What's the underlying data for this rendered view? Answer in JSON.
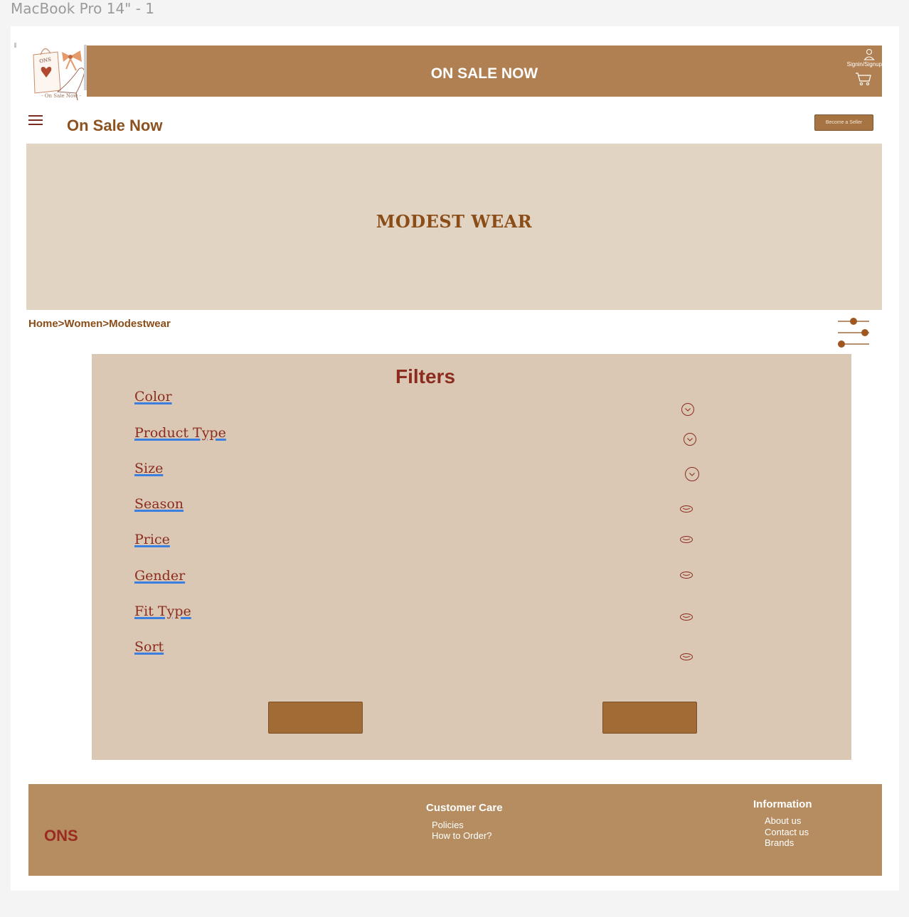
{
  "frame_title": "MacBook Pro 14\" - 1",
  "logo": {
    "text": "ONS",
    "tagline": "- On Sale Now -"
  },
  "header": {
    "title": "ON SALE NOW",
    "signin_label": "Signin/Signup",
    "icons": [
      "user-icon",
      "cart-icon"
    ]
  },
  "nav": {
    "brand": "On Sale Now",
    "become_seller_label": "Become a Seller",
    "menu_icon": "hamburger-icon"
  },
  "banner": {
    "title": "MODEST WEAR"
  },
  "breadcrumb": "Home>Women>Modestwear",
  "filters": {
    "title": "Filters",
    "items": [
      {
        "label": "Color",
        "icon": "chevron-circle-icon"
      },
      {
        "label": "Product Type",
        "icon": "chevron-circle-icon"
      },
      {
        "label": "Size",
        "icon": "chevron-circle-icon"
      },
      {
        "label": "Season",
        "icon": "lip-chevron-icon"
      },
      {
        "label": "Price",
        "icon": "lip-chevron-icon"
      },
      {
        "label": "Gender",
        "icon": "lip-chevron-icon"
      },
      {
        "label": "Fit Type",
        "icon": "lip-chevron-icon"
      },
      {
        "label": "Sort",
        "icon": "lip-chevron-icon"
      }
    ]
  },
  "footer": {
    "brand": "ONS",
    "customer_care": {
      "heading": "Customer Care",
      "links": [
        "Policies",
        "How to Order?"
      ]
    },
    "information": {
      "heading": "Information",
      "links": [
        "About us",
        "Contact us",
        "Brands"
      ]
    }
  },
  "colors": {
    "header_bg": "#b08052",
    "banner_bg": "#e2d4c3",
    "panel_bg": "#dac8b5",
    "footer_bg": "#b58d60",
    "accent_text": "#8b2c1f",
    "brown_text": "#8b4d17",
    "button_bg": "#a06b35"
  }
}
